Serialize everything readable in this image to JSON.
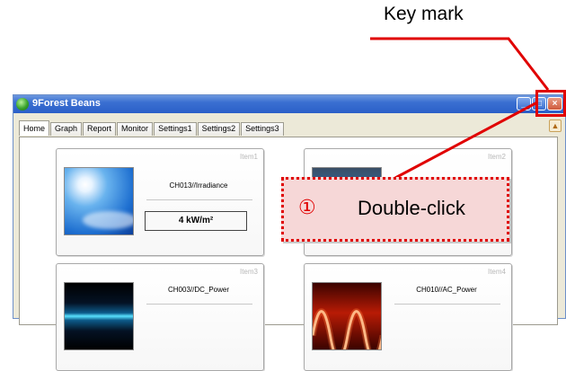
{
  "annotation": {
    "key_mark_label": "Key mark",
    "step_number": "①",
    "step_action": "Double-click"
  },
  "window": {
    "title": "9Forest Beans",
    "controls": {
      "minimize": "_",
      "maximize": "□",
      "close": "×"
    }
  },
  "tabs": [
    "Home",
    "Graph",
    "Report",
    "Monitor",
    "Settings1",
    "Settings2",
    "Settings3"
  ],
  "tab_scroll": "▲",
  "cards": [
    {
      "label": "Item1",
      "channel": "CH013//Irradiance",
      "value": "4  kW/m²",
      "icon": "irradiance-thumbnail"
    },
    {
      "label": "Item2",
      "channel": "",
      "value": "",
      "icon": "item2-thumbnail"
    },
    {
      "label": "Item3",
      "channel": "CH003//DC_Power",
      "value": "",
      "icon": "dc-power-thumbnail"
    },
    {
      "label": "Item4",
      "channel": "CH010//AC_Power",
      "value": "",
      "icon": "ac-power-thumbnail"
    }
  ],
  "colors": {
    "annotation_red": "#e00000",
    "callout_fill": "#f6d7d7",
    "titlebar_blue": "#2b5fc8"
  }
}
